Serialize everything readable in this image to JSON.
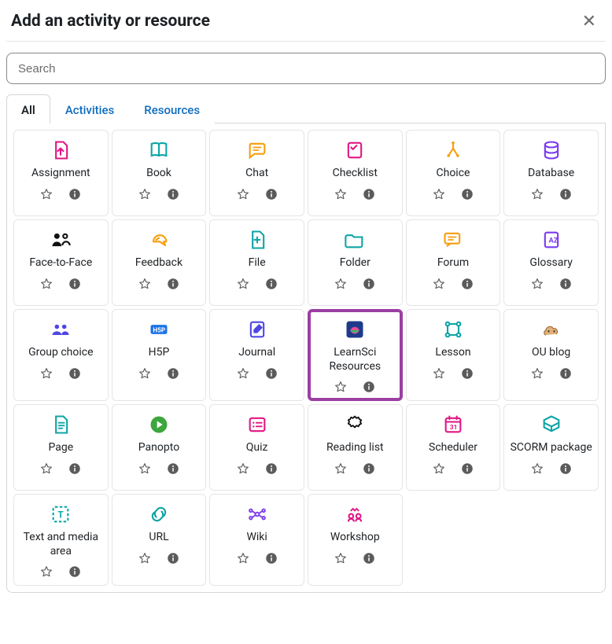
{
  "modal": {
    "title": "Add an activity or resource",
    "close_aria": "Close"
  },
  "search": {
    "placeholder": "Search",
    "value": ""
  },
  "tabs": {
    "all": "All",
    "activities": "Activities",
    "resources": "Resources"
  },
  "icons": {
    "star": "star-outline",
    "info": "info-circle"
  },
  "items": [
    {
      "id": "assignment",
      "label": "Assignment",
      "icon": "assignment-icon",
      "color": "#e21583",
      "highlighted": false
    },
    {
      "id": "book",
      "label": "Book",
      "icon": "book-icon",
      "color": "#0ea5a5",
      "highlighted": false
    },
    {
      "id": "chat",
      "label": "Chat",
      "icon": "chat-icon",
      "color": "#f59e0b",
      "highlighted": false
    },
    {
      "id": "checklist",
      "label": "Checklist",
      "icon": "checklist-icon",
      "color": "#e21583",
      "highlighted": false
    },
    {
      "id": "choice",
      "label": "Choice",
      "icon": "choice-icon",
      "color": "#f59e0b",
      "highlighted": false
    },
    {
      "id": "database",
      "label": "Database",
      "icon": "database-icon",
      "color": "#7c3aed",
      "highlighted": false
    },
    {
      "id": "face-to-face",
      "label": "Face-to-Face",
      "icon": "face-to-face-icon",
      "color": "#111111",
      "highlighted": false
    },
    {
      "id": "feedback",
      "label": "Feedback",
      "icon": "feedback-icon",
      "color": "#f59e0b",
      "highlighted": false
    },
    {
      "id": "file",
      "label": "File",
      "icon": "file-icon",
      "color": "#0ea5a5",
      "highlighted": false
    },
    {
      "id": "folder",
      "label": "Folder",
      "icon": "folder-icon",
      "color": "#0ea5a5",
      "highlighted": false
    },
    {
      "id": "forum",
      "label": "Forum",
      "icon": "forum-icon",
      "color": "#f59e0b",
      "highlighted": false
    },
    {
      "id": "glossary",
      "label": "Glossary",
      "icon": "glossary-icon",
      "color": "#7c3aed",
      "highlighted": false
    },
    {
      "id": "group-choice",
      "label": "Group choice",
      "icon": "group-choice-icon",
      "color": "#4f46e5",
      "highlighted": false
    },
    {
      "id": "h5p",
      "label": "H5P",
      "icon": "h5p-icon",
      "color": "#1b73e8",
      "highlighted": false
    },
    {
      "id": "journal",
      "label": "Journal",
      "icon": "journal-icon",
      "color": "#4f46e5",
      "highlighted": false
    },
    {
      "id": "learnsci",
      "label": "LearnSci Resources",
      "icon": "learnsci-icon",
      "color": "#1e3a8a",
      "highlighted": true
    },
    {
      "id": "lesson",
      "label": "Lesson",
      "icon": "lesson-icon",
      "color": "#0ea5a5",
      "highlighted": false
    },
    {
      "id": "oublog",
      "label": "OU blog",
      "icon": "oublog-icon",
      "color": "#c27a33",
      "highlighted": false
    },
    {
      "id": "page",
      "label": "Page",
      "icon": "page-icon",
      "color": "#0ea5a5",
      "highlighted": false
    },
    {
      "id": "panopto",
      "label": "Panopto",
      "icon": "panopto-icon",
      "color": "#3da63d",
      "highlighted": false
    },
    {
      "id": "quiz",
      "label": "Quiz",
      "icon": "quiz-icon",
      "color": "#e21583",
      "highlighted": false
    },
    {
      "id": "reading-list",
      "label": "Reading list",
      "icon": "reading-list-icon",
      "color": "#111111",
      "highlighted": false
    },
    {
      "id": "scheduler",
      "label": "Scheduler",
      "icon": "scheduler-icon",
      "color": "#e21583",
      "highlighted": false
    },
    {
      "id": "scorm",
      "label": "SCORM package",
      "icon": "scorm-icon",
      "color": "#0ea5a5",
      "highlighted": false
    },
    {
      "id": "text-media",
      "label": "Text and media area",
      "icon": "text-media-icon",
      "color": "#0ea5a5",
      "highlighted": false
    },
    {
      "id": "url",
      "label": "URL",
      "icon": "url-icon",
      "color": "#0ea5a5",
      "highlighted": false
    },
    {
      "id": "wiki",
      "label": "Wiki",
      "icon": "wiki-icon",
      "color": "#7c3aed",
      "highlighted": false
    },
    {
      "id": "workshop",
      "label": "Workshop",
      "icon": "workshop-icon",
      "color": "#e21583",
      "highlighted": false
    }
  ]
}
